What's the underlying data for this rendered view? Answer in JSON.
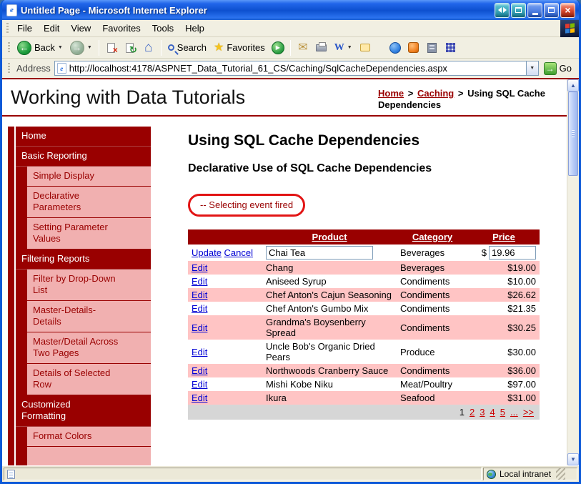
{
  "window": {
    "title": "Untitled Page - Microsoft Internet Explorer"
  },
  "menu": {
    "items": [
      "File",
      "Edit",
      "View",
      "Favorites",
      "Tools",
      "Help"
    ]
  },
  "toolbar": {
    "back_label": "Back",
    "search_label": "Search",
    "favorites_label": "Favorites"
  },
  "address": {
    "label": "Address",
    "url": "http://localhost:4178/ASPNET_Data_Tutorial_61_CS/Caching/SqlCacheDependencies.aspx",
    "go_label": "Go"
  },
  "banner": {
    "site_title": "Working with Data Tutorials",
    "breadcrumb": {
      "home": "Home",
      "separator": ">",
      "section": "Caching",
      "current": "Using SQL Cache Dependencies"
    }
  },
  "sidebar": {
    "items": [
      {
        "label": "Home",
        "type": "section"
      },
      {
        "label": "Basic Reporting",
        "type": "section"
      },
      {
        "label": "Simple Display",
        "type": "sub"
      },
      {
        "label": "Declarative Parameters",
        "type": "sub"
      },
      {
        "label": "Setting Parameter Values",
        "type": "sub"
      },
      {
        "label": "Filtering Reports",
        "type": "section"
      },
      {
        "label": "Filter by Drop-Down List",
        "type": "sub"
      },
      {
        "label": "Master-Details-Details",
        "type": "sub"
      },
      {
        "label": "Master/Detail Across Two Pages",
        "type": "sub"
      },
      {
        "label": "Details of Selected Row",
        "type": "sub"
      },
      {
        "label": "Customized Formatting",
        "type": "section"
      },
      {
        "label": "Format Colors",
        "type": "sub"
      }
    ]
  },
  "content": {
    "title": "Using SQL Cache Dependencies",
    "subtitle": "Declarative Use of SQL Cache Dependencies",
    "event_label": "-- Selecting event fired",
    "grid": {
      "headers": {
        "product": "Product",
        "category": "Category",
        "price": "Price"
      },
      "edit_label": "Edit",
      "edit_row": {
        "update": "Update",
        "cancel": "Cancel",
        "product": "Chai Tea",
        "category": "Beverages",
        "currency": "$",
        "price": "19.96"
      },
      "rows": [
        {
          "product": "Chang",
          "category": "Beverages",
          "price": "$19.00"
        },
        {
          "product": "Aniseed Syrup",
          "category": "Condiments",
          "price": "$10.00"
        },
        {
          "product": "Chef Anton's Cajun Seasoning",
          "category": "Condiments",
          "price": "$26.62"
        },
        {
          "product": "Chef Anton's Gumbo Mix",
          "category": "Condiments",
          "price": "$21.35"
        },
        {
          "product": "Grandma's Boysenberry Spread",
          "category": "Condiments",
          "price": "$30.25"
        },
        {
          "product": "Uncle Bob's Organic Dried Pears",
          "category": "Produce",
          "price": "$30.00"
        },
        {
          "product": "Northwoods Cranberry Sauce",
          "category": "Condiments",
          "price": "$36.00"
        },
        {
          "product": "Mishi Kobe Niku",
          "category": "Meat/Poultry",
          "price": "$97.00"
        },
        {
          "product": "Ikura",
          "category": "Seafood",
          "price": "$31.00"
        }
      ],
      "pager": {
        "current": "1",
        "links": [
          "2",
          "3",
          "4",
          "5",
          "...",
          ">>"
        ]
      }
    }
  },
  "statusbar": {
    "zone_label": "Local intranet"
  },
  "icons": {
    "back_arrow": "←",
    "forward_arrow": "→",
    "dropdown": "▼",
    "star": "★",
    "mail": "✉",
    "refresh": "↻",
    "home": "⌂",
    "stop": "×",
    "close": "×",
    "go_arrow": "→",
    "scroll_up": "▲",
    "scroll_down": "▼",
    "word": "W",
    "media_play": "▶"
  },
  "colors": {
    "maroon": "#990000",
    "sidebar_pink": "#f1b0b0",
    "row_pink": "#ffc4c4",
    "link_blue": "#0000d4",
    "pager_red": "#cc0000",
    "titlebar_blue": "#0d50cf"
  }
}
